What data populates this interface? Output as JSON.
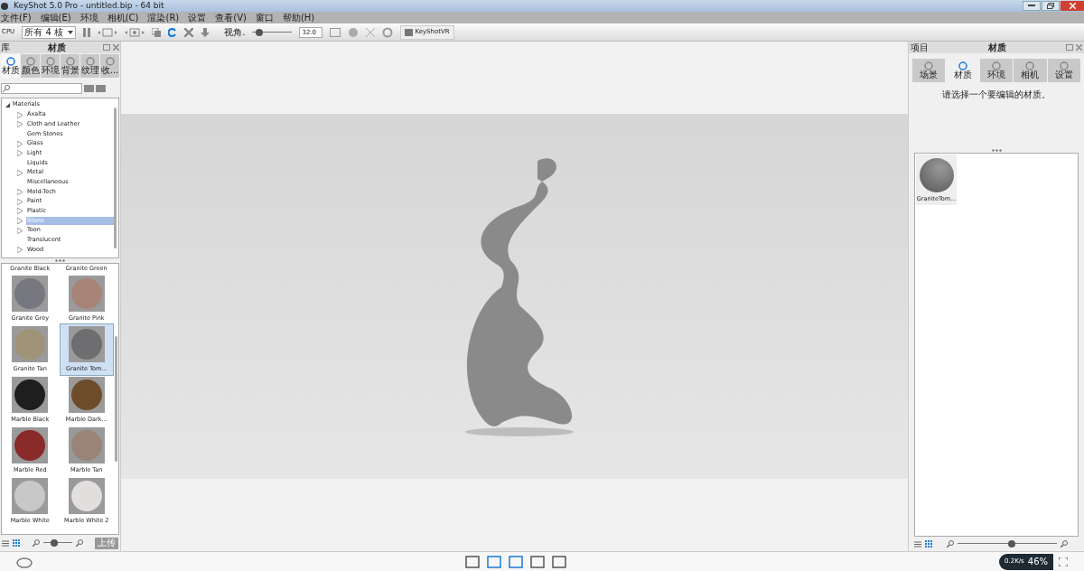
{
  "window": {
    "title": "KeyShot 5.0 Pro  - untitled.bip  - 64 bit"
  },
  "menu": [
    "文件(F)",
    "编辑(E)",
    "环境",
    "相机(C)",
    "渲染(R)",
    "设置",
    "查看(V)",
    "窗口",
    "帮助(H)"
  ],
  "toolbar": {
    "cpu_label": "CPU",
    "cpu_select": "所有 4 核",
    "fov_label": "视角.",
    "fov_slider": {
      "level": 0.1
    },
    "fov_value": "32.0",
    "vr_button": "KeyShotVR"
  },
  "library": {
    "tab_cut": "库",
    "title": "材质",
    "tabs": [
      {
        "label": "材质",
        "selected": true
      },
      {
        "label": "颜色",
        "selected": false
      },
      {
        "label": "环境",
        "selected": false
      },
      {
        "label": "背景",
        "selected": false
      },
      {
        "label": "纹理",
        "selected": false
      },
      {
        "label": "收...",
        "selected": false
      }
    ],
    "tree": {
      "label": "Materials",
      "expanded": true,
      "children": [
        {
          "label": "Axalta",
          "expandable": true,
          "selected": false
        },
        {
          "label": "Cloth and Leather",
          "expandable": true,
          "selected": false
        },
        {
          "label": "Gem Stones",
          "expandable": false,
          "selected": false
        },
        {
          "label": "Glass",
          "expandable": true,
          "selected": false
        },
        {
          "label": "Light",
          "expandable": true,
          "selected": false
        },
        {
          "label": "Liquids",
          "expandable": false,
          "selected": false
        },
        {
          "label": "Metal",
          "expandable": true,
          "selected": false
        },
        {
          "label": "Miscellaneous",
          "expandable": false,
          "selected": false
        },
        {
          "label": "Mold-Tech",
          "expandable": true,
          "selected": false
        },
        {
          "label": "Paint",
          "expandable": true,
          "selected": false
        },
        {
          "label": "Plastic",
          "expandable": true,
          "selected": false
        },
        {
          "label": "Stone",
          "expandable": true,
          "selected": true
        },
        {
          "label": "Toon",
          "expandable": true,
          "selected": false
        },
        {
          "label": "Translucent",
          "expandable": false,
          "selected": false
        },
        {
          "label": "Wood",
          "expandable": true,
          "selected": false
        }
      ]
    },
    "top_labels": [
      "Granite Black",
      "Granite Green"
    ],
    "materials": [
      {
        "label": "Granite Grey",
        "color": "#77777f",
        "selected": false
      },
      {
        "label": "Granite Pink",
        "color": "#a88478",
        "selected": false
      },
      {
        "label": "Granite Tan",
        "color": "#a09478",
        "selected": false
      },
      {
        "label": "Granite Tom...",
        "color": "#6e6e70",
        "selected": true
      },
      {
        "label": "Marble Black",
        "color": "#1e1e1e",
        "selected": false
      },
      {
        "label": "Marble Dark...",
        "color": "#6e4c2a",
        "selected": false
      },
      {
        "label": "Marble Red",
        "color": "#8a2a2a",
        "selected": false
      },
      {
        "label": "Marble Tan",
        "color": "#9a8478",
        "selected": false
      },
      {
        "label": "Marble White",
        "color": "#c8c8c8",
        "selected": false
      },
      {
        "label": "Marble White 2",
        "color": "#e2dede",
        "selected": false
      }
    ],
    "zoom_slider": {
      "level": 0.35
    },
    "upload_button": "上传"
  },
  "project": {
    "tab_cut": "项目",
    "title": "材质",
    "tabs": [
      {
        "label": "场景",
        "selected": false
      },
      {
        "label": "材质",
        "selected": true
      },
      {
        "label": "环境",
        "selected": false
      },
      {
        "label": "相机",
        "selected": false
      },
      {
        "label": "设置",
        "selected": false
      }
    ],
    "message": "请选择一个要编辑的材质。",
    "thumbnail": "GraniteTom...",
    "zoom_slider": {
      "level": 0.55
    }
  },
  "status": {
    "speed": "0.2K/s",
    "percent": "46%"
  }
}
